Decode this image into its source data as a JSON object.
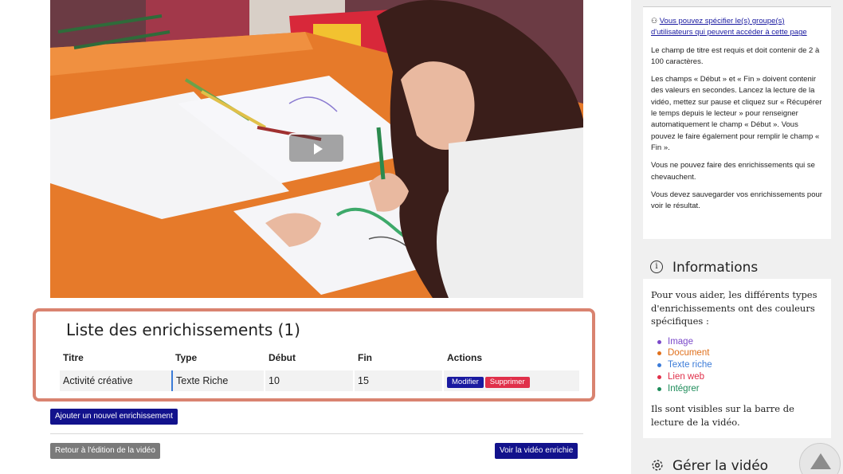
{
  "video": {
    "play_button_label": "Lire la vidéo"
  },
  "enrichments": {
    "title": "Liste des enrichissements (1)",
    "columns": [
      "Titre",
      "Type",
      "Début",
      "Fin",
      "Actions"
    ],
    "rows": [
      {
        "titre": "Activité créative",
        "type": "Texte Riche",
        "debut": "10",
        "fin": "15",
        "modifier": "Modifier",
        "supprimer": "Supprimer"
      }
    ],
    "type_color": "#3b7bd8"
  },
  "actions": {
    "add_label": "Ajouter un nouvel enrichissement",
    "back_label": "Retour à l'édition de la vidéo",
    "view_label": "Voir la vidéo enrichie"
  },
  "help": {
    "group_link": "Vous pouvez spécifier le(s) groupe(s) d'utilisateurs qui peuvent accéder à cette page",
    "p1": "Le champ de titre est requis et doit contenir de 2 à 100 caractères.",
    "p2": "Les champs « Début » et « Fin » doivent contenir des valeurs en secondes. Lancez la lecture de la vidéo, mettez sur pause et cliquez sur « Récupérer le temps depuis le lecteur » pour renseigner automatiquement le champ « Début ». Vous pouvez le faire également pour remplir le champ « Fin ».",
    "p3": "Vous ne pouvez faire des enrichissements qui se chevauchent.",
    "p4": "Vous devez sauvegarder vos enrichissements pour voir le résultat."
  },
  "info": {
    "icon": "info-icon",
    "title": "Informations",
    "intro": "Pour vous aider, les différents types d'enrichissements ont des couleurs spécifiques :",
    "legend": [
      {
        "label": "Image",
        "color": "#7b49c9"
      },
      {
        "label": "Document",
        "color": "#e0701c"
      },
      {
        "label": "Texte riche",
        "color": "#3b7bd8"
      },
      {
        "label": "Lien web",
        "color": "#e0304a"
      },
      {
        "label": "Intégrer",
        "color": "#1e8c5a"
      }
    ],
    "outro": "Ils sont visibles sur la barre de lecture de la vidéo."
  },
  "manage": {
    "icon": "gear-icon",
    "title": "Gérer la vidéo"
  }
}
